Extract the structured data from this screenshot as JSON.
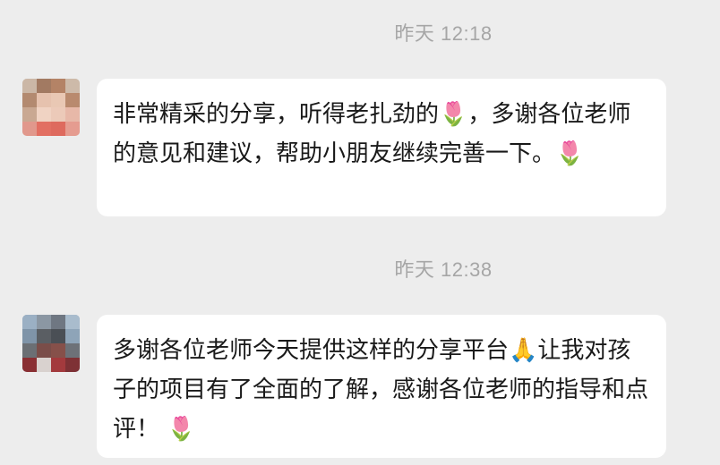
{
  "chat": {
    "messages": [
      {
        "time": "昨天 12:18",
        "avatar_icon": "user-avatar-pixelated",
        "text": "非常精采的分享，听得老扎劲的🌷，多谢各位老师的意见和建议，帮助小朋友继续完善一下。🌷"
      },
      {
        "time": "昨天 12:38",
        "avatar_icon": "user-avatar-pixelated",
        "text": "多谢各位老师今天提供这样的分享平台🙏让我对孩子的项目有了全面的了解，感谢各位老师的指导和点评！ 🌷"
      }
    ]
  }
}
